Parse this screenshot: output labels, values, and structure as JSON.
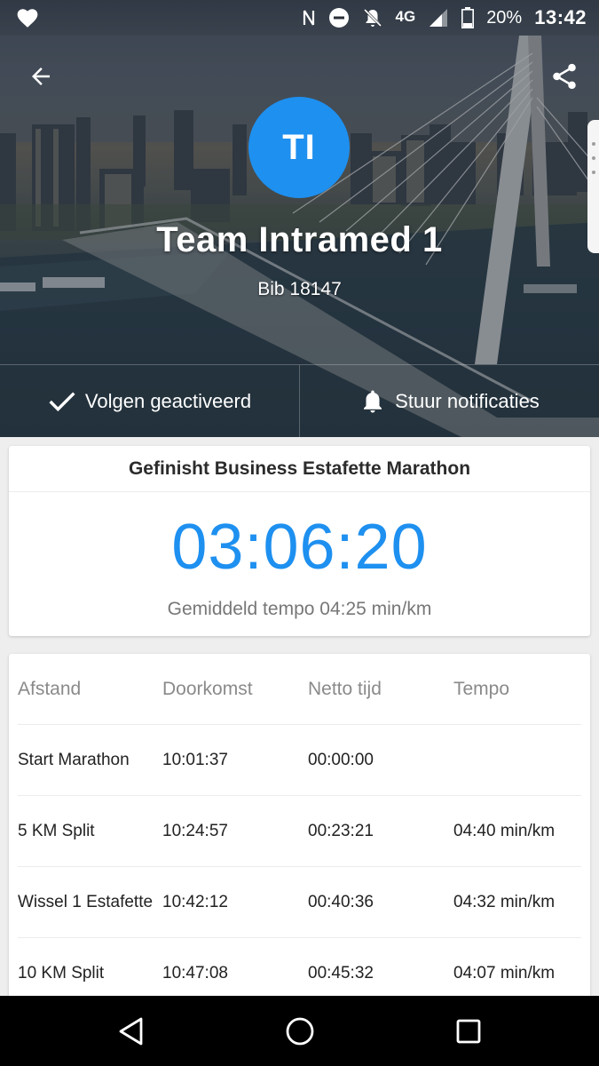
{
  "status_bar": {
    "network": "4G",
    "battery_percent": "20%",
    "time": "13:42",
    "icons": [
      "heart-icon",
      "nfc-icon",
      "do-not-disturb-icon",
      "notifications-off-icon",
      "signal-icon",
      "battery-icon"
    ]
  },
  "header": {
    "avatar_initials": "TI",
    "team_name": "Team Intramed 1",
    "bib": "Bib 18147",
    "follow_label": "Volgen geactiveerd",
    "notify_label": "Stuur notificaties",
    "accent_color": "#1e90f0"
  },
  "result": {
    "title": "Gefinisht Business Estafette Marathon",
    "time": "03:06:20",
    "pace": "Gemiddeld tempo 04:25 min/km"
  },
  "splits": {
    "headers": [
      "Afstand",
      "Doorkomst",
      "Netto tijd",
      "Tempo"
    ],
    "rows": [
      {
        "afstand": "Start Marathon",
        "doorkomst": "10:01:37",
        "netto": "00:00:00",
        "tempo": ""
      },
      {
        "afstand": "5 KM Split",
        "doorkomst": "10:24:57",
        "netto": "00:23:21",
        "tempo": "04:40 min/km"
      },
      {
        "afstand": "Wissel 1 Estafette",
        "doorkomst": "10:42:12",
        "netto": "00:40:36",
        "tempo": "04:32 min/km"
      },
      {
        "afstand": "10 KM Split",
        "doorkomst": "10:47:08",
        "netto": "00:45:32",
        "tempo": "04:07 min/km"
      }
    ]
  }
}
